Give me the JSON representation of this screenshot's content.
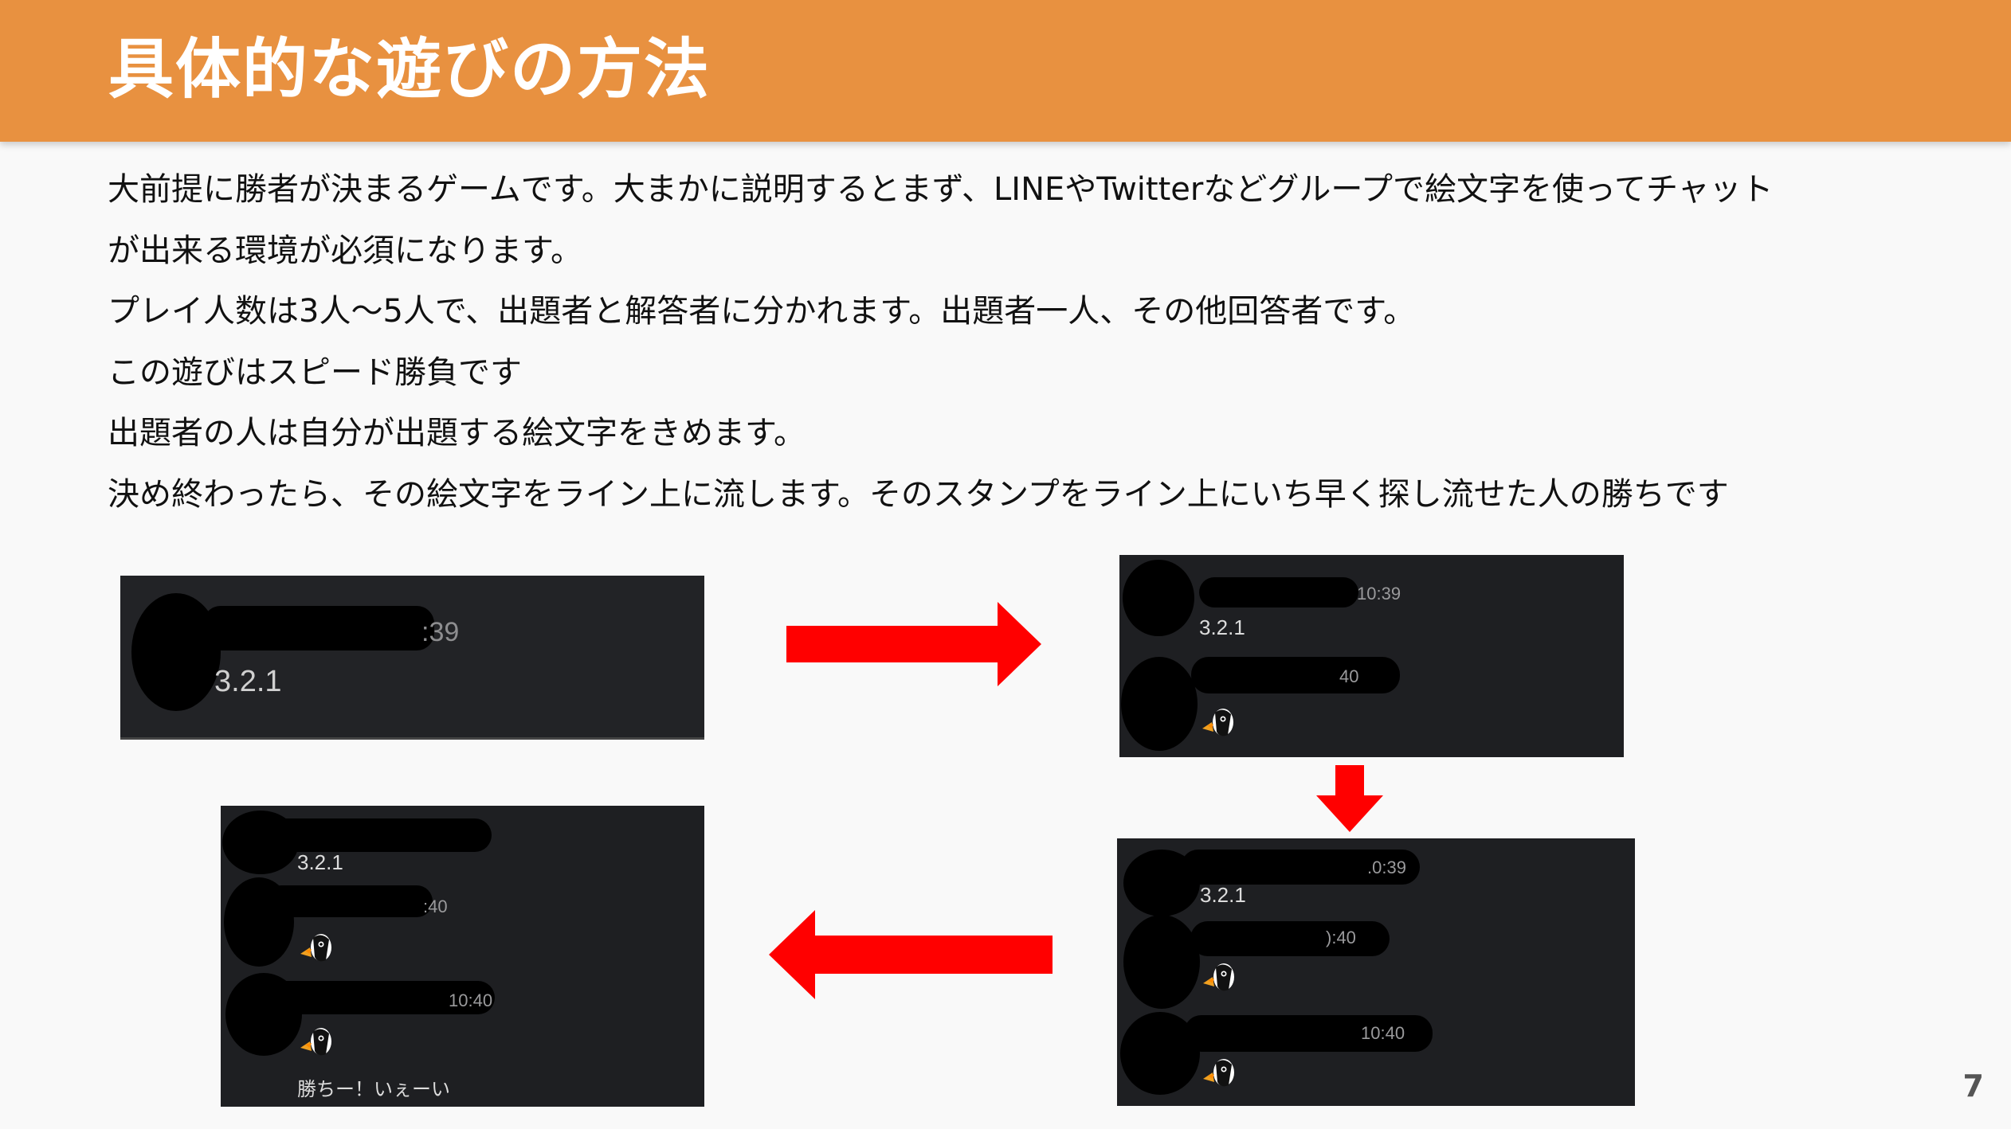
{
  "slide": {
    "title": "具体的な遊びの方法",
    "page_number": "7",
    "body_lines": [
      "大前提に勝者が決まるゲームです。大まかに説明するとまず、LINEやTwitterなどグループで絵文字を使ってチャット",
      "が出来る環境が必須になります。",
      "プレイ人数は3人〜5人で、出題者と解答者に分かれます。出題者一人、その他回答者です。",
      "この遊びはスピード勝負です",
      "出題者の人は自分が出題する絵文字をきめます。",
      "決め終わったら、その絵文字をライン上に流します。そのスタンプをライン上にいち早く探し流せた人の勝ちです"
    ]
  },
  "screenshots": {
    "step1": {
      "time": ":39",
      "message": "3.2.1"
    },
    "step2": {
      "time1": "10:39",
      "message": "3.2.1",
      "time2": "40",
      "sticker": "bird-emoji-icon"
    },
    "step3": {
      "time1": ".0:39",
      "message": "3.2.1",
      "time2": "):40",
      "time3": "10:40",
      "sticker": "bird-emoji-icon"
    },
    "step4": {
      "message": "3.2.1",
      "time2": ":40",
      "time3": "10:40",
      "win_message": "勝ちー！いぇーい",
      "sticker": "bird-emoji-icon"
    }
  },
  "colors": {
    "header": "#e89140",
    "background": "#f9f9f9",
    "arrow": "#ff0000",
    "chat_bg": "#1e1f22"
  }
}
